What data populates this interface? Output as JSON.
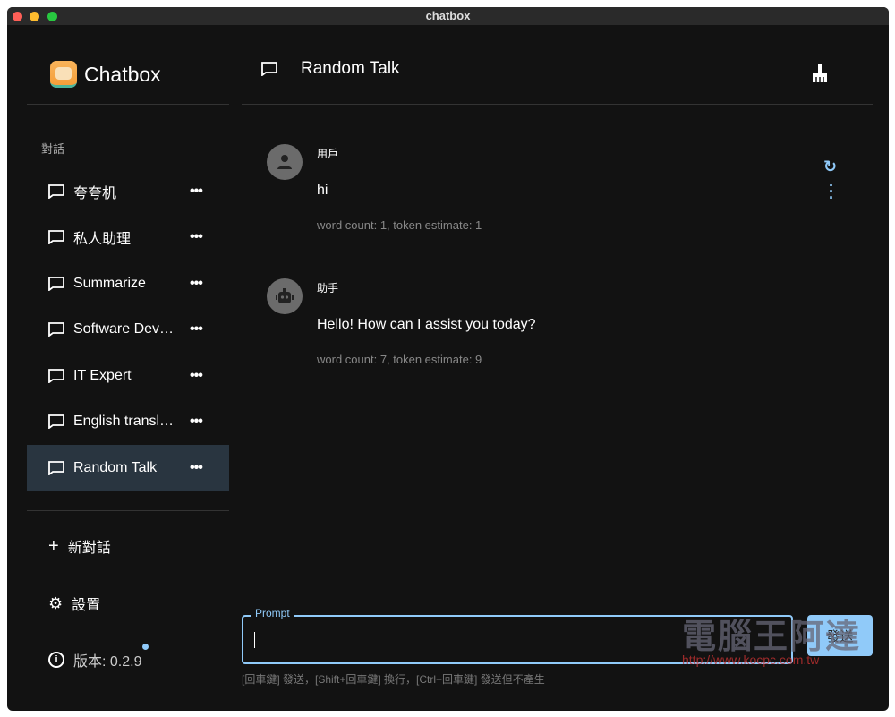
{
  "window": {
    "title": "chatbox"
  },
  "sidebar": {
    "app_name": "Chatbox",
    "section_title": "對話",
    "items": [
      {
        "label": "夸夸机"
      },
      {
        "label": "私人助理"
      },
      {
        "label": "Summarize"
      },
      {
        "label": "Software Developer"
      },
      {
        "label": "IT Expert"
      },
      {
        "label": "English translator"
      },
      {
        "label": "Random Talk"
      }
    ],
    "new_chat": "新對話",
    "settings": "設置",
    "version": "版本: 0.2.9"
  },
  "header": {
    "title": "Random Talk"
  },
  "messages": [
    {
      "role": "用戶",
      "text": "hi",
      "meta": "word count: 1, token estimate: 1"
    },
    {
      "role": "助手",
      "text": "Hello! How can I assist you today?",
      "meta": "word count: 7, token estimate: 9"
    }
  ],
  "input": {
    "label": "Prompt",
    "value": "",
    "send": "發送",
    "hint": "[回車鍵] 發送，[Shift+回車鍵] 換行，[Ctrl+回車鍵] 發送但不產生"
  },
  "watermark": {
    "text": "電腦王阿達",
    "url": "http://www.kocpc.com.tw"
  },
  "colors": {
    "accent": "#90caf9",
    "active": "#293540",
    "bg": "#121212"
  }
}
